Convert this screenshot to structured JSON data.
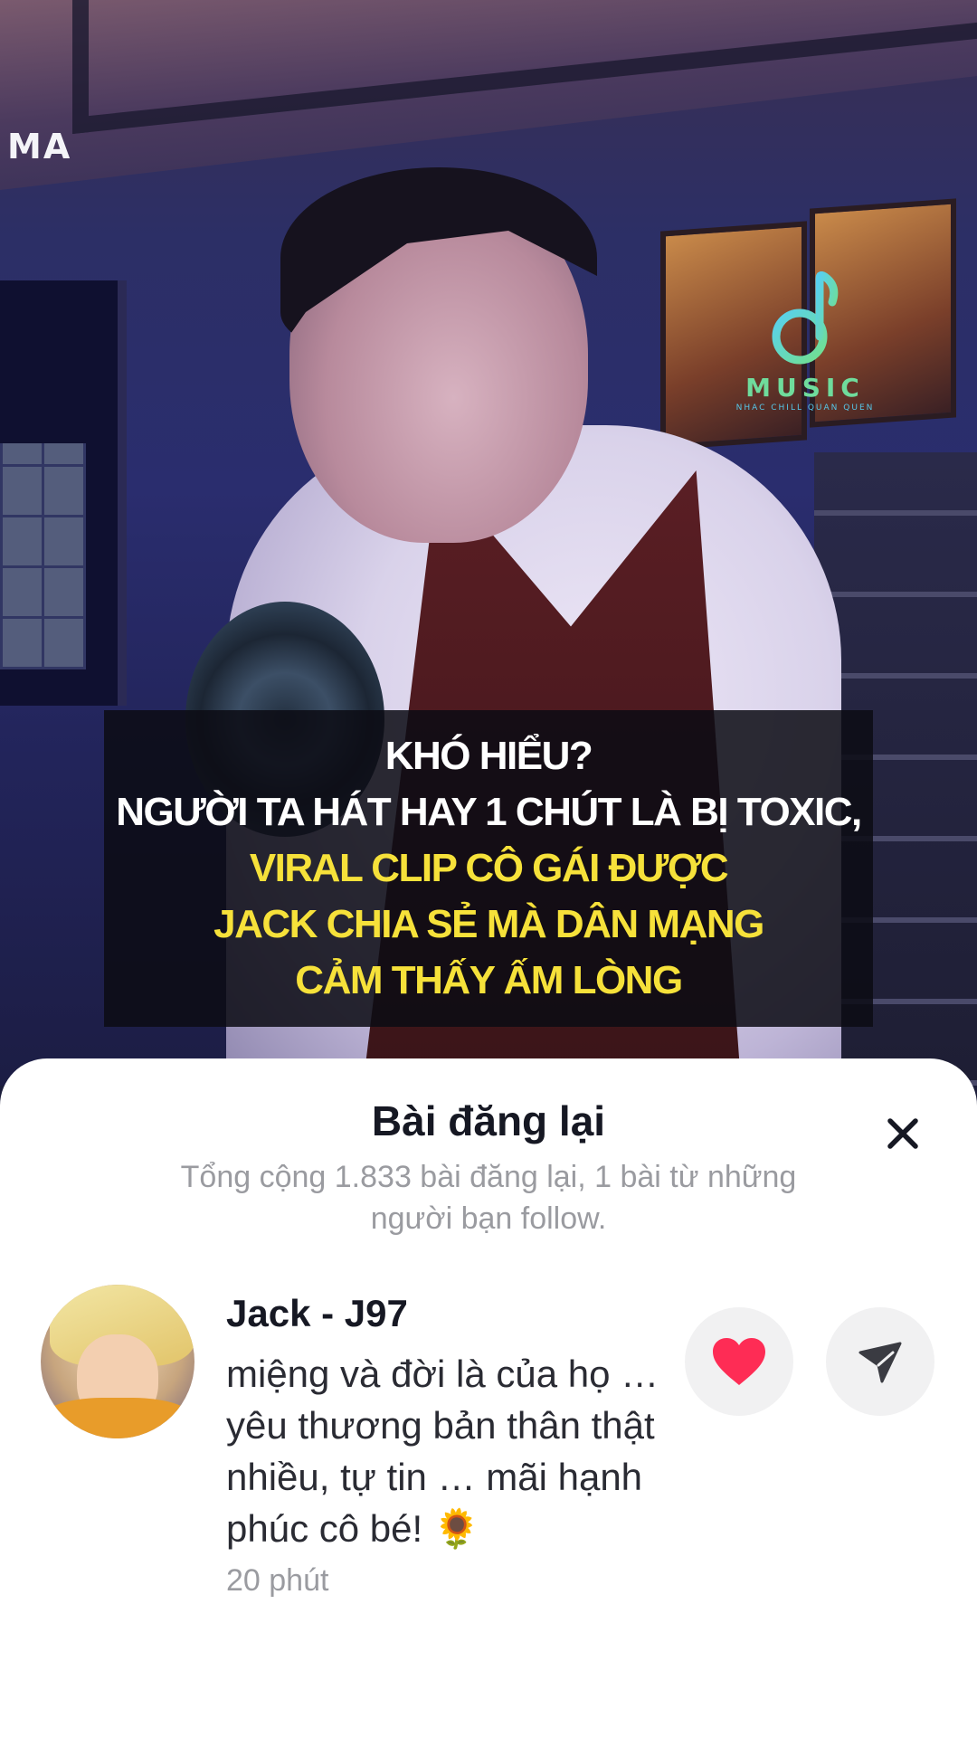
{
  "video": {
    "corner_mark": "MA",
    "logo": {
      "word": "MUSIC",
      "sub": "NHAC CHILL QUAN QUEN"
    },
    "caption": {
      "lines": [
        "KHÓ HIỂU?",
        "NGƯỜI TA HÁT HAY 1 CHÚT LÀ BỊ TOXIC,",
        "VIRAL CLIP CÔ GÁI ĐƯỢC",
        "JACK CHIA SẺ MÀ DÂN MẠNG",
        "CẢM THẤY ẤM LÒNG"
      ],
      "colors": {
        "white": "#ffffff",
        "yellow": "#f6e13a"
      }
    }
  },
  "sheet": {
    "title": "Bài đăng lại",
    "subtitle": "Tổng cộng 1.833 bài đăng lại, 1 bài từ những người bạn follow.",
    "close_icon": "close-icon",
    "repost": {
      "username": "Jack - J97",
      "text": "miệng và đời là của họ … yêu thương bản thân thật nhiều, tự tin … mãi hạnh phúc cô bé! 🌻",
      "time": "20 phút",
      "like_icon": "heart-icon",
      "like_color": "#fe2c55",
      "share_icon": "send-icon"
    }
  }
}
